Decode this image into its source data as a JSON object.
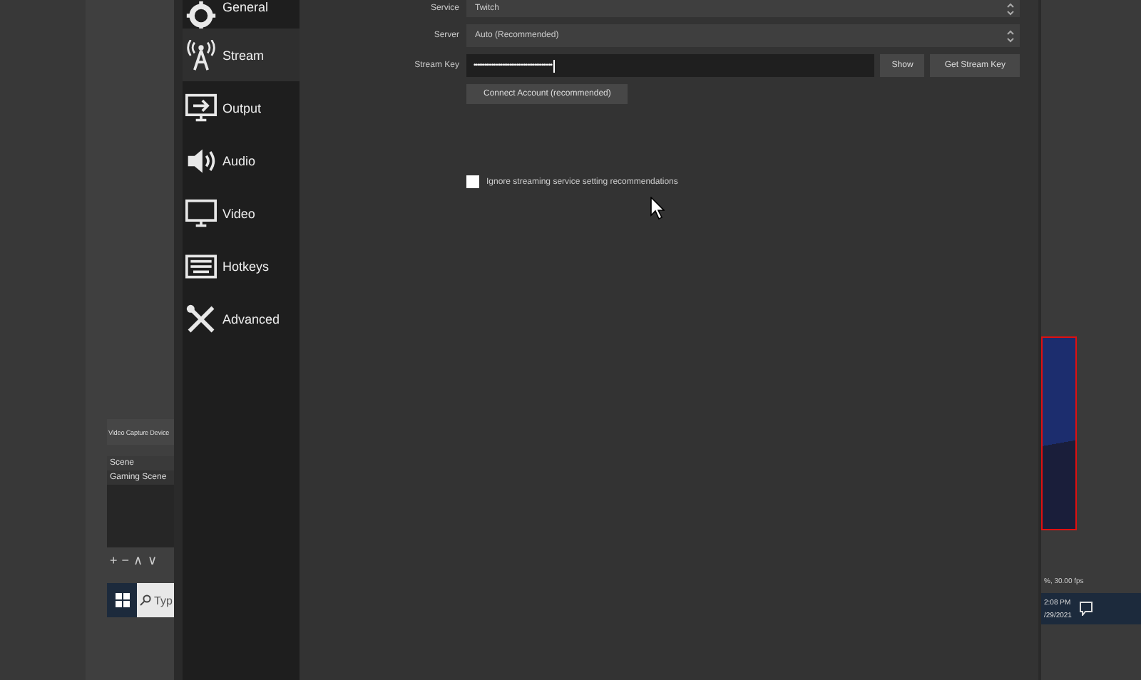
{
  "settings": {
    "sidebar": {
      "items": [
        {
          "label": "General",
          "selected": false
        },
        {
          "label": "Stream",
          "selected": true
        },
        {
          "label": "Output",
          "selected": false
        },
        {
          "label": "Audio",
          "selected": false
        },
        {
          "label": "Video",
          "selected": false
        },
        {
          "label": "Hotkeys",
          "selected": false
        },
        {
          "label": "Advanced",
          "selected": false
        }
      ]
    },
    "stream": {
      "fields": [
        {
          "label": "Service",
          "value": "Twitch",
          "kind": "select"
        },
        {
          "label": "Server",
          "value": "Auto (Recommended)",
          "kind": "select"
        },
        {
          "label": "Stream Key",
          "value": "••••••••••••••••••••••••••••••••••••••••••••",
          "kind": "secret",
          "buttons": [
            "Show",
            "Get Stream Key"
          ]
        }
      ],
      "connect_button": "Connect Account (recommended)",
      "ignore_checkbox": {
        "label": "Ignore streaming service setting recommendations",
        "checked": false
      }
    }
  },
  "background": {
    "source_title": "Video Capture Device",
    "scenes": {
      "header": "Scene",
      "items": [
        {
          "label": "Gaming Scene"
        }
      ]
    },
    "scene_controls": [
      "+",
      "−",
      "∧",
      "∨"
    ],
    "taskbar_search": {
      "placeholder": "Typ"
    },
    "status": "%, 30.00 fps",
    "clock": {
      "time": "2:08 PM",
      "date": "/29/2021"
    }
  }
}
